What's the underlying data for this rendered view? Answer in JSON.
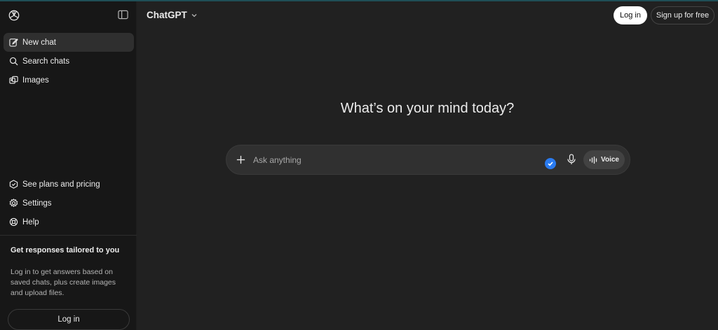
{
  "sidebar": {
    "logo_icon": "openai-logo-icon",
    "toggle_icon": "sidebar-toggle-icon",
    "nav": [
      {
        "label": "New chat",
        "icon": "edit-icon",
        "active": true
      },
      {
        "label": "Search chats",
        "icon": "search-icon",
        "active": false
      },
      {
        "label": "Images",
        "icon": "images-icon",
        "active": false
      }
    ],
    "bottom_nav": [
      {
        "label": "See plans and pricing",
        "icon": "plans-icon"
      },
      {
        "label": "Settings",
        "icon": "gear-icon"
      },
      {
        "label": "Help",
        "icon": "help-icon"
      }
    ],
    "promo": {
      "title": "Get responses tailored to you",
      "text": "Log in to get answers based on saved chats, plus create images and upload files."
    },
    "login_label": "Log in"
  },
  "header": {
    "model": "ChatGPT",
    "login_label": "Log in",
    "signup_label": "Sign up for free"
  },
  "main": {
    "headline": "What’s on your mind today?",
    "composer": {
      "placeholder": "Ask anything",
      "value": "",
      "voice_label": "Voice"
    }
  },
  "colors": {
    "background": "#212121",
    "sidebar": "#171717",
    "composer": "#303030",
    "accent_blue": "#2a7bf0"
  }
}
